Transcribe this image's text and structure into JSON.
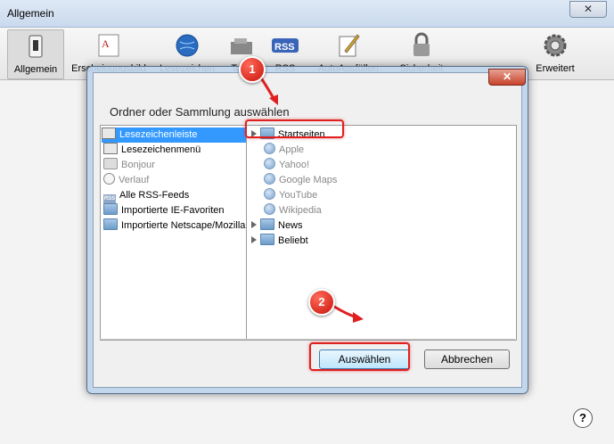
{
  "window": {
    "title": "Allgemein",
    "close_symbol": "✕"
  },
  "toolbar": {
    "items": [
      {
        "label": "Allgemein",
        "icon": "switch-icon"
      },
      {
        "label": "Erscheinungsbild",
        "icon": "font-icon"
      },
      {
        "label": "Lesezeichen",
        "icon": "globe-icon"
      },
      {
        "label": "Tabs",
        "icon": "tabs-icon"
      },
      {
        "label": "RSS",
        "icon": "rss-icon"
      },
      {
        "label": "AutoAusfüllen",
        "icon": "pencil-icon"
      },
      {
        "label": "Sicherheit",
        "icon": "lock-icon"
      },
      {
        "label": "Erweitert",
        "icon": "gear-icon"
      }
    ]
  },
  "dialog": {
    "heading": "Ordner oder Sammlung auswählen",
    "close_symbol": "✕",
    "left_items": [
      {
        "label": "Lesezeichenleiste",
        "icon": "book-icon",
        "selected": true
      },
      {
        "label": "Lesezeichenmenü",
        "icon": "book-icon",
        "selected": false
      },
      {
        "label": "Bonjour",
        "icon": "bonjour-icon",
        "dimmed": true
      },
      {
        "label": "Verlauf",
        "icon": "clock-icon",
        "dimmed": true
      },
      {
        "label": "Alle RSS-Feeds",
        "icon": "rss-icon",
        "dimmed": false
      },
      {
        "label": "Importierte IE-Favoriten",
        "icon": "folder-icon",
        "dimmed": false
      },
      {
        "label": "Importierte Netscape/Mozilla",
        "icon": "folder-icon",
        "dimmed": false
      }
    ],
    "right_items": [
      {
        "label": "Startseiten",
        "type": "folder",
        "expandable": true
      },
      {
        "label": "Apple",
        "type": "bookmark"
      },
      {
        "label": "Yahoo!",
        "type": "bookmark"
      },
      {
        "label": "Google Maps",
        "type": "bookmark"
      },
      {
        "label": "YouTube",
        "type": "bookmark"
      },
      {
        "label": "Wikipedia",
        "type": "bookmark"
      },
      {
        "label": "News",
        "type": "folder",
        "expandable": true
      },
      {
        "label": "Beliebt",
        "type": "folder",
        "expandable": true
      }
    ],
    "select_label": "Auswählen",
    "cancel_label": "Abbrechen"
  },
  "annotations": {
    "marker1": "1",
    "marker2": "2",
    "color": "#e02020"
  },
  "help_symbol": "?"
}
